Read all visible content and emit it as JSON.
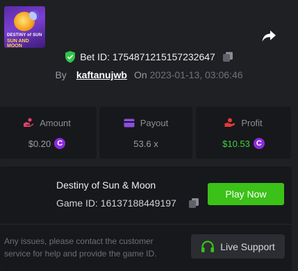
{
  "header": {
    "share_icon": "share-arrow-icon",
    "bet_id_label": "Bet ID: 1754871215157232647",
    "by_label": "By",
    "username": "kaftanujwb",
    "on_label": "On",
    "datetime": "2023-01-13, 03:06:46"
  },
  "stats": {
    "amount": {
      "label": "Amount",
      "value": "$0.20",
      "icon": "hand-coins-icon",
      "color": "#e0406a"
    },
    "payout": {
      "label": "Payout",
      "value": "53.6 x",
      "icon": "wallet-card-icon",
      "color": "#8b4fe0"
    },
    "profit": {
      "label": "Profit",
      "value": "$10.53",
      "icon": "hand-money-icon",
      "color": "#e03a3a"
    },
    "coin_glyph": "C"
  },
  "game": {
    "thumb_line1": "DESTINY of SUN",
    "thumb_line2": "SUN AND MOON",
    "title": "Destiny of Sun & Moon",
    "game_id_label": "Game ID: 16137188449197",
    "play_label": "Play Now",
    "support_text": "Any issues, please contact the customer service for help and provide the game ID.",
    "support_label": "Live Support"
  },
  "colors": {
    "accent_green": "#3bc117",
    "profit_green": "#3fd33f",
    "coin_purple": "#8b2bde",
    "background": "#1f2024",
    "panel": "#17181b"
  }
}
